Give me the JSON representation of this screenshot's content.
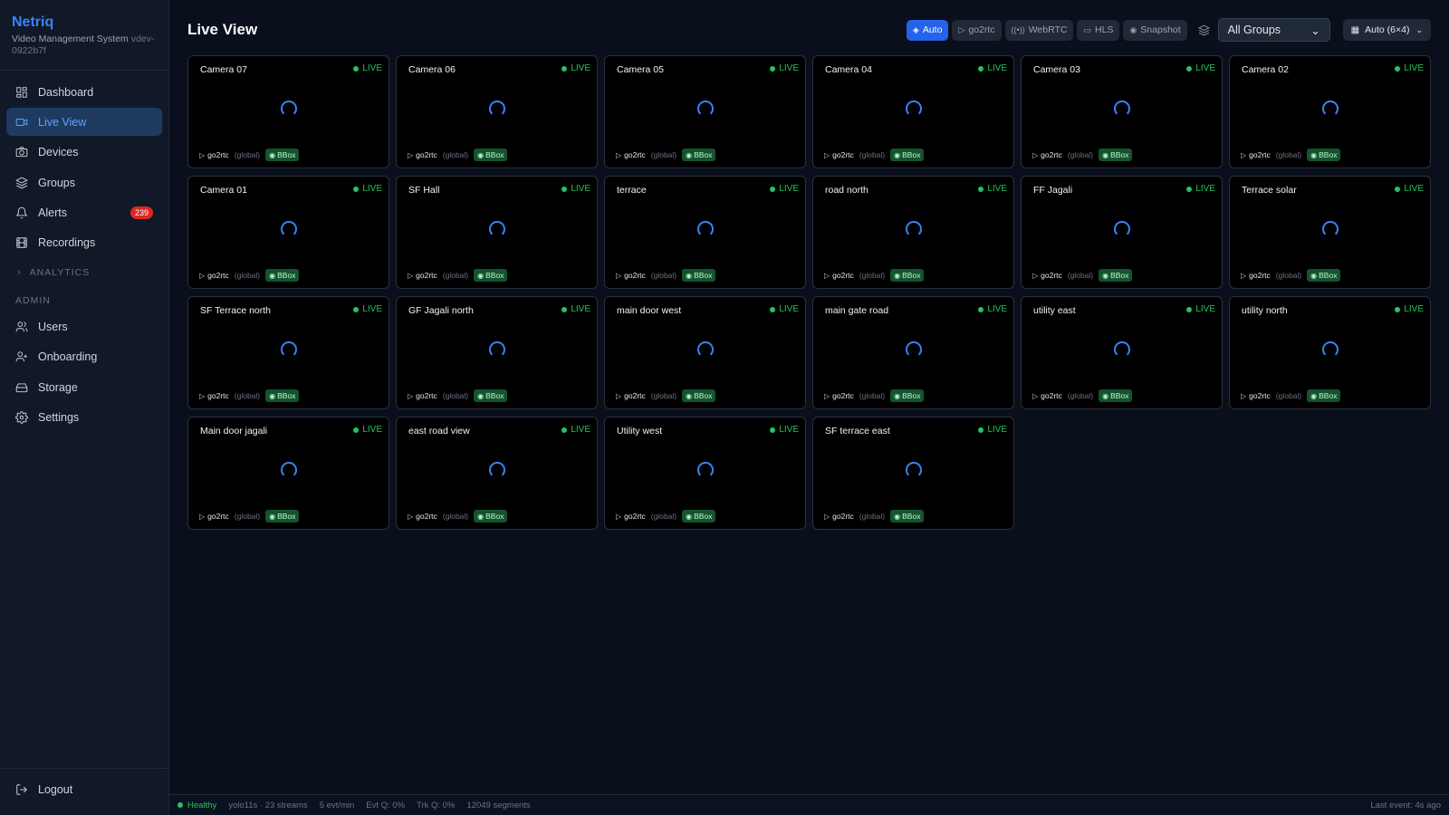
{
  "brand": {
    "name": "Netriq",
    "subtitle": "Video Management System",
    "version": "vdev-0922b7f"
  },
  "nav": [
    {
      "label": "Dashboard",
      "icon": "dashboard-icon",
      "active": false
    },
    {
      "label": "Live View",
      "icon": "video-icon",
      "active": true
    },
    {
      "label": "Devices",
      "icon": "camera-icon",
      "active": false
    },
    {
      "label": "Groups",
      "icon": "layers-icon",
      "active": false
    },
    {
      "label": "Alerts",
      "icon": "bell-icon",
      "active": false,
      "badge": "239"
    },
    {
      "label": "Recordings",
      "icon": "film-icon",
      "active": false
    }
  ],
  "analytics_label": "ANALYTICS",
  "admin_label": "ADMIN",
  "admin_nav": [
    {
      "label": "Users",
      "icon": "users-icon"
    },
    {
      "label": "Onboarding",
      "icon": "user-plus-icon"
    },
    {
      "label": "Storage",
      "icon": "storage-icon"
    },
    {
      "label": "Settings",
      "icon": "gear-icon"
    }
  ],
  "logout_label": "Logout",
  "page_title": "Live View",
  "modes": [
    {
      "label": "Auto",
      "icon": "layers-icon",
      "active": true
    },
    {
      "label": "go2rtc",
      "icon": "play-icon",
      "active": false
    },
    {
      "label": "WebRTC",
      "icon": "broadcast-icon",
      "active": false
    },
    {
      "label": "HLS",
      "icon": "monitor-icon",
      "active": false
    },
    {
      "label": "Snapshot",
      "icon": "camera-icon",
      "active": false
    }
  ],
  "group_select": "All Groups",
  "grid_select": "Auto (6×4)",
  "tile_common": {
    "live_label": "LIVE",
    "protocol": "go2rtc",
    "scope": "(global)",
    "bbox_label": "BBox"
  },
  "cameras": [
    "Camera 07",
    "Camera 06",
    "Camera 05",
    "Camera 04",
    "Camera 03",
    "Camera 02",
    "Camera 01",
    "SF Hall",
    "terrace",
    "road north",
    "FF Jagali",
    "Terrace solar",
    "SF Terrace north",
    "GF Jagali north",
    "main door west",
    "main gate road",
    "utility east",
    "utility north",
    "Main door jagali",
    "east road view",
    "Utility west",
    "SF terrace east"
  ],
  "status": {
    "health": "Healthy",
    "model": "yolo11s · 23 streams",
    "rate": "5 evt/min",
    "evt_q": "Evt Q: 0%",
    "trk_q": "Trk Q: 0%",
    "segments": "12049 segments",
    "last_event": "Last event: 4s ago"
  },
  "colors": {
    "accent": "#3b82f6",
    "live": "#22c55e",
    "alert_badge": "#dc2626"
  }
}
